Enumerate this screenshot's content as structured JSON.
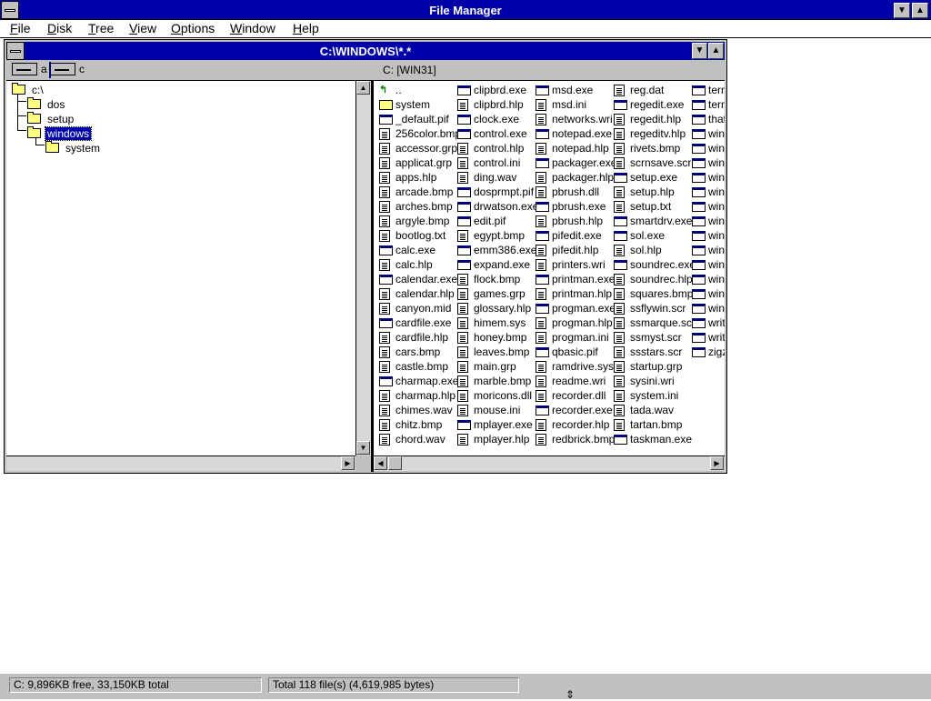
{
  "app": {
    "title": "File Manager"
  },
  "menu": [
    {
      "accel": "F",
      "rest": "ile"
    },
    {
      "accel": "D",
      "rest": "isk"
    },
    {
      "accel": "T",
      "rest": "ree"
    },
    {
      "accel": "V",
      "rest": "iew"
    },
    {
      "accel": "O",
      "rest": "ptions"
    },
    {
      "accel": "W",
      "rest": "indow"
    },
    {
      "accel": "H",
      "rest": "elp"
    }
  ],
  "child": {
    "title": "C:\\WINDOWS\\*.*",
    "drives": [
      {
        "label": "a"
      },
      {
        "label": "c"
      }
    ],
    "volume": "C: [WIN31]"
  },
  "tree": [
    {
      "label": "c:\\"
    },
    {
      "label": "dos"
    },
    {
      "label": "setup"
    },
    {
      "label": "windows"
    },
    {
      "label": "system"
    }
  ],
  "files": {
    "columns": [
      [
        "..",
        "system",
        "_default.pif",
        "256color.bmp",
        "accessor.grp",
        "applicat.grp",
        "apps.hlp",
        "arcade.bmp",
        "arches.bmp",
        "argyle.bmp",
        "bootlog.txt",
        "calc.exe",
        "calc.hlp",
        "calendar.exe",
        "calendar.hlp",
        "canyon.mid",
        "cardfile.exe",
        "cardfile.hlp",
        "cars.bmp",
        "castle.bmp",
        "charmap.exe",
        "charmap.hlp",
        "chimes.wav",
        "chitz.bmp",
        "chord.wav"
      ],
      [
        "clipbrd.exe",
        "clipbrd.hlp",
        "clock.exe",
        "control.exe",
        "control.hlp",
        "control.ini",
        "ding.wav",
        "dosprmpt.pif",
        "drwatson.exe",
        "edit.pif",
        "egypt.bmp",
        "emm386.exe",
        "expand.exe",
        "flock.bmp",
        "games.grp",
        "glossary.hlp",
        "himem.sys",
        "honey.bmp",
        "leaves.bmp",
        "main.grp",
        "marble.bmp",
        "moricons.dll",
        "mouse.ini",
        "mplayer.exe",
        "mplayer.hlp"
      ],
      [
        "msd.exe",
        "msd.ini",
        "networks.wri",
        "notepad.exe",
        "notepad.hlp",
        "packager.exe",
        "packager.hlp",
        "pbrush.dll",
        "pbrush.exe",
        "pbrush.hlp",
        "pifedit.exe",
        "pifedit.hlp",
        "printers.wri",
        "printman.exe",
        "printman.hlp",
        "progman.exe",
        "progman.hlp",
        "progman.ini",
        "qbasic.pif",
        "ramdrive.sys",
        "readme.wri",
        "recorder.dll",
        "recorder.exe",
        "recorder.hlp",
        "redbrick.bmp"
      ],
      [
        "reg.dat",
        "regedit.exe",
        "regedit.hlp",
        "regeditv.hlp",
        "rivets.bmp",
        "scrnsave.scr",
        "setup.exe",
        "setup.hlp",
        "setup.txt",
        "smartdrv.exe",
        "sol.exe",
        "sol.hlp",
        "soundrec.exe",
        "soundrec.hlp",
        "squares.bmp",
        "ssflywin.scr",
        "ssmarque.scr",
        "ssmyst.scr",
        "ssstars.scr",
        "startup.grp",
        "sysini.wri",
        "system.ini",
        "tada.wav",
        "tartan.bmp",
        "taskman.exe"
      ],
      [
        "termi",
        "termi",
        "thatc",
        "win.c",
        "win.i",
        "winfi",
        "winfi",
        "winh",
        "winh",
        "winin",
        "winlo",
        "winm",
        "winm",
        "wintu",
        "wintu",
        "winv",
        "write",
        "write",
        "zigza"
      ]
    ]
  },
  "status": {
    "disk": "C: 9,896KB free,  33,150KB total",
    "files": "Total 118 file(s) (4,619,985 bytes)"
  }
}
